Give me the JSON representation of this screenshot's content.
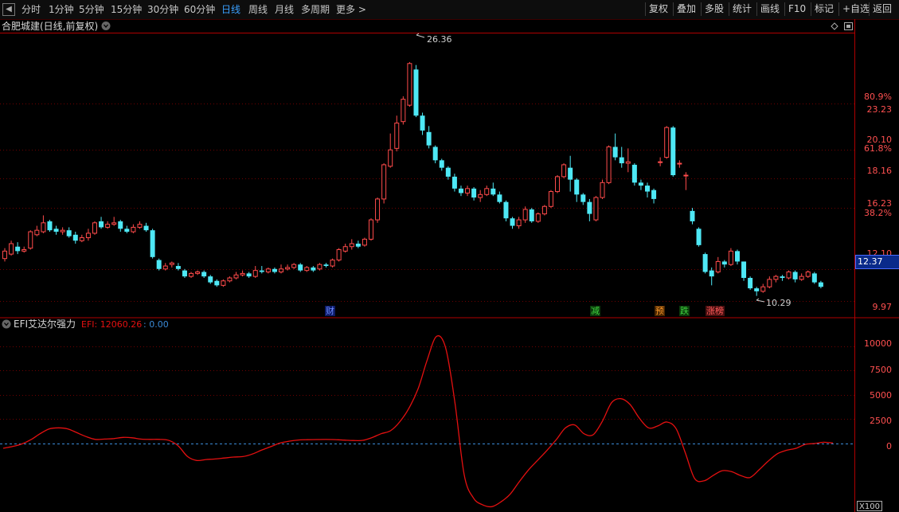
{
  "toolbar": {
    "back_icon": "left-arrow-box-icon",
    "periods": [
      "分时",
      "1分钟",
      "5分钟",
      "15分钟",
      "30分钟",
      "60分钟",
      "日线",
      "周线",
      "月线",
      "多周期",
      "更多 >"
    ],
    "active_period": "日线",
    "buttons": [
      "复权",
      "叠加",
      "多股",
      "统计",
      "画线",
      "F10",
      "标记",
      "+自选",
      "返回"
    ]
  },
  "main_panel": {
    "title": "合肥城建(日线,前复权)",
    "title_dropdown_icon": "chevron-down-circle-icon",
    "corner_icons": [
      "diamond-icon",
      "square-icon"
    ],
    "price_axis": [
      "23.23",
      "80.9%",
      "20.10",
      "61.8%",
      "18.16",
      "16.23",
      "38.2%",
      "12.10",
      "9.97"
    ],
    "current_price": "12.37",
    "high_label": "26.36",
    "low_label": "10.29",
    "event_tags": [
      {
        "text": "财",
        "color": "#2a4bd8",
        "bg": "#0c1a66"
      },
      {
        "text": "减",
        "color": "#3fd23f",
        "bg": "#0b3a0b"
      },
      {
        "text": "预",
        "color": "#ff9a2a",
        "bg": "#4a2600"
      },
      {
        "text": "跌",
        "color": "#3fd23f",
        "bg": "#0b3a0b"
      },
      {
        "text": "涨榜",
        "color": "#ff5a5a",
        "bg": "#4a1010"
      }
    ]
  },
  "indicator_panel": {
    "collapse_icon": "chevron-down-circle-icon",
    "name": "EFI艾达尔强力",
    "value_text": "EFI: 12060.26",
    "zero_text": ": 0.00",
    "axis": [
      "10000",
      "7500",
      "5000",
      "2500",
      "0"
    ],
    "scale_label": "X100"
  },
  "colors": {
    "up": "#ff4b4b",
    "down": "#4ee8f5",
    "grid": "#6e0000",
    "efi_line": "#e41010",
    "zero_line": "#3a8ad8"
  },
  "chart_data": {
    "type": "candlestick",
    "ylim": [
      9.2,
      27.6
    ],
    "candles": [
      [
        12.8,
        13.3,
        12.6,
        13.5
      ],
      [
        13.1,
        13.8,
        13.0,
        14.0
      ],
      [
        13.6,
        13.3,
        13.1,
        13.9
      ],
      [
        13.3,
        13.4,
        13.2,
        13.6
      ],
      [
        13.5,
        14.6,
        13.4,
        14.7
      ],
      [
        14.4,
        14.7,
        14.3,
        15.0
      ],
      [
        14.6,
        15.2,
        14.5,
        15.7
      ],
      [
        15.3,
        14.7,
        14.6,
        15.4
      ],
      [
        14.8,
        14.6,
        14.4,
        15.0
      ],
      [
        14.6,
        14.7,
        14.4,
        14.9
      ],
      [
        14.7,
        14.3,
        14.2,
        14.9
      ],
      [
        14.4,
        14.0,
        13.8,
        14.6
      ],
      [
        14.0,
        14.2,
        13.9,
        14.4
      ],
      [
        14.2,
        14.5,
        14.0,
        14.8
      ],
      [
        14.5,
        15.2,
        14.4,
        15.3
      ],
      [
        15.3,
        14.9,
        14.8,
        15.6
      ],
      [
        14.9,
        15.1,
        14.8,
        15.3
      ],
      [
        15.1,
        15.2,
        15.0,
        15.6
      ],
      [
        15.3,
        14.8,
        14.6,
        15.4
      ],
      [
        14.8,
        14.6,
        14.5,
        15.0
      ],
      [
        14.6,
        14.9,
        14.5,
        15.1
      ],
      [
        14.9,
        15.1,
        14.8,
        15.3
      ],
      [
        15.0,
        14.7,
        14.6,
        15.2
      ],
      [
        14.7,
        12.9,
        12.8,
        14.8
      ],
      [
        12.7,
        12.1,
        12.0,
        12.8
      ],
      [
        12.1,
        12.3,
        12.0,
        12.5
      ],
      [
        12.4,
        12.5,
        12.2,
        12.6
      ],
      [
        12.3,
        12.1,
        12.0,
        12.5
      ],
      [
        12.0,
        11.6,
        11.5,
        12.1
      ],
      [
        11.6,
        11.8,
        11.5,
        11.9
      ],
      [
        11.8,
        11.9,
        11.7,
        12.0
      ],
      [
        11.9,
        11.6,
        11.5,
        12.0
      ],
      [
        11.6,
        11.2,
        11.1,
        11.7
      ],
      [
        11.3,
        11.0,
        10.9,
        11.4
      ],
      [
        11.0,
        11.3,
        10.9,
        11.4
      ],
      [
        11.3,
        11.5,
        11.2,
        11.6
      ],
      [
        11.5,
        11.7,
        11.4,
        11.9
      ],
      [
        11.7,
        11.8,
        11.6,
        12.0
      ],
      [
        11.8,
        11.6,
        11.5,
        11.9
      ],
      [
        11.6,
        12.0,
        11.5,
        12.3
      ],
      [
        12.0,
        11.9,
        11.8,
        12.3
      ],
      [
        11.9,
        12.1,
        11.8,
        12.2
      ],
      [
        12.1,
        11.9,
        11.8,
        12.2
      ],
      [
        11.9,
        12.1,
        11.8,
        12.4
      ],
      [
        12.1,
        12.2,
        12.0,
        12.4
      ],
      [
        12.2,
        12.4,
        12.1,
        12.5
      ],
      [
        12.4,
        12.0,
        11.9,
        12.5
      ],
      [
        12.0,
        12.2,
        11.9,
        12.3
      ],
      [
        12.2,
        12.0,
        11.9,
        12.3
      ],
      [
        12.1,
        12.4,
        12.0,
        12.5
      ],
      [
        12.4,
        12.3,
        12.2,
        12.5
      ],
      [
        12.3,
        12.7,
        12.2,
        12.8
      ],
      [
        12.7,
        13.4,
        12.6,
        13.5
      ],
      [
        13.3,
        13.6,
        13.2,
        13.8
      ],
      [
        13.6,
        13.8,
        13.4,
        14.1
      ],
      [
        13.8,
        13.6,
        13.5,
        14.0
      ],
      [
        13.7,
        14.1,
        13.6,
        14.2
      ],
      [
        14.1,
        15.4,
        14.0,
        15.5
      ],
      [
        15.4,
        16.8,
        15.2,
        16.9
      ],
      [
        16.8,
        19.1,
        16.5,
        19.2
      ],
      [
        19.0,
        20.1,
        18.9,
        21.2
      ],
      [
        20.2,
        21.9,
        20.0,
        22.4
      ],
      [
        22.0,
        23.5,
        21.8,
        23.7
      ],
      [
        23.1,
        25.9,
        23.0,
        26.0
      ],
      [
        25.5,
        22.4,
        22.3,
        25.8
      ],
      [
        22.4,
        21.4,
        21.1,
        22.6
      ],
      [
        21.3,
        20.4,
        20.2,
        21.7
      ],
      [
        20.3,
        19.4,
        19.2,
        20.4
      ],
      [
        19.4,
        18.9,
        18.7,
        19.5
      ],
      [
        18.9,
        18.3,
        18.1,
        19.0
      ],
      [
        18.3,
        17.5,
        17.3,
        18.5
      ],
      [
        17.5,
        17.2,
        17.0,
        17.7
      ],
      [
        17.2,
        17.5,
        17.0,
        17.7
      ],
      [
        17.5,
        16.9,
        16.7,
        17.6
      ],
      [
        16.9,
        17.1,
        16.6,
        17.4
      ],
      [
        17.1,
        17.5,
        17.0,
        17.7
      ],
      [
        17.5,
        17.1,
        17.0,
        17.9
      ],
      [
        17.1,
        16.6,
        16.5,
        17.3
      ],
      [
        16.6,
        15.5,
        15.3,
        16.7
      ],
      [
        15.5,
        15.0,
        14.8,
        15.6
      ],
      [
        15.0,
        15.4,
        14.8,
        15.6
      ],
      [
        15.4,
        16.1,
        15.2,
        16.3
      ],
      [
        16.1,
        15.3,
        15.2,
        16.2
      ],
      [
        15.3,
        15.8,
        15.2,
        15.9
      ],
      [
        15.8,
        16.3,
        15.7,
        16.4
      ],
      [
        16.3,
        17.3,
        16.2,
        17.4
      ],
      [
        17.3,
        18.3,
        17.2,
        18.4
      ],
      [
        18.3,
        19.1,
        18.2,
        19.2
      ],
      [
        18.9,
        18.1,
        17.3,
        19.7
      ],
      [
        18.1,
        17.1,
        16.6,
        18.2
      ],
      [
        17.1,
        16.6,
        16.4,
        17.2
      ],
      [
        16.6,
        15.8,
        15.3,
        16.8
      ],
      [
        15.4,
        16.9,
        15.3,
        17.0
      ],
      [
        16.9,
        17.9,
        16.8,
        18.1
      ],
      [
        17.9,
        20.3,
        17.8,
        20.4
      ],
      [
        20.3,
        19.6,
        19.4,
        21.2
      ],
      [
        19.6,
        19.2,
        18.9,
        20.3
      ],
      [
        19.2,
        19.3,
        18.6,
        20.2
      ],
      [
        19.1,
        17.9,
        17.7,
        19.2
      ],
      [
        17.9,
        17.7,
        17.4,
        18.1
      ],
      [
        17.7,
        17.3,
        16.9,
        17.9
      ],
      [
        17.4,
        16.8,
        16.5,
        17.5
      ],
      [
        19.3,
        19.3,
        19.0,
        19.6
      ],
      [
        19.6,
        21.6,
        19.5,
        21.7
      ],
      [
        21.6,
        18.4,
        18.3,
        21.7
      ],
      [
        19.2,
        19.2,
        18.9,
        19.4
      ],
      [
        18.4,
        18.4,
        17.4,
        18.6
      ],
      [
        16.0,
        15.3,
        15.1,
        16.2
      ],
      [
        14.8,
        13.7,
        13.6,
        14.9
      ],
      [
        13.1,
        11.9,
        11.8,
        13.2
      ],
      [
        12.0,
        11.6,
        11.0,
        12.2
      ],
      [
        11.9,
        12.6,
        11.8,
        12.9
      ],
      [
        12.6,
        12.4,
        12.2,
        12.7
      ],
      [
        12.4,
        13.3,
        12.3,
        13.5
      ],
      [
        13.3,
        12.6,
        12.4,
        13.4
      ],
      [
        12.6,
        11.5,
        11.3,
        12.6
      ],
      [
        11.5,
        10.8,
        10.7,
        11.6
      ],
      [
        10.8,
        10.6,
        10.29,
        10.9
      ],
      [
        10.6,
        10.9,
        10.5,
        11.1
      ],
      [
        10.9,
        11.4,
        10.8,
        11.6
      ],
      [
        11.4,
        11.6,
        11.2,
        11.7
      ],
      [
        11.6,
        11.5,
        11.3,
        11.7
      ],
      [
        11.5,
        11.9,
        11.4,
        12.0
      ],
      [
        11.9,
        11.4,
        11.2,
        12.0
      ],
      [
        11.4,
        11.6,
        11.3,
        11.8
      ],
      [
        11.6,
        11.9,
        11.5,
        12.0
      ],
      [
        11.8,
        11.2,
        11.1,
        11.9
      ],
      [
        11.2,
        10.9,
        10.8,
        11.3
      ]
    ],
    "efi_ylim": [
      -6800,
      11200
    ],
    "efi": [
      -500,
      -320,
      -60,
      380,
      1000,
      1500,
      1600,
      1500,
      1100,
      700,
      420,
      450,
      500,
      620,
      580,
      440,
      420,
      420,
      300,
      -260,
      -1350,
      -1750,
      -1650,
      -1600,
      -1500,
      -1400,
      -1350,
      -1100,
      -700,
      -340,
      30,
      230,
      350,
      380,
      400,
      410,
      390,
      340,
      300,
      320,
      600,
      1000,
      1300,
      2200,
      3600,
      5600,
      8600,
      11000,
      9800,
      4200,
      -3200,
      -5600,
      -6300,
      -6500,
      -6000,
      -5200,
      -3900,
      -2700,
      -1700,
      -700,
      400,
      1600,
      1900,
      1000,
      900,
      2300,
      4200,
      4600,
      4000,
      2600,
      1600,
      1800,
      2200,
      1500,
      -1000,
      -3600,
      -3850,
      -3300,
      -2800,
      -2900,
      -3300,
      -3500,
      -2700,
      -1800,
      -1050,
      -700,
      -500,
      -100,
      -10,
      120,
      40
    ]
  }
}
